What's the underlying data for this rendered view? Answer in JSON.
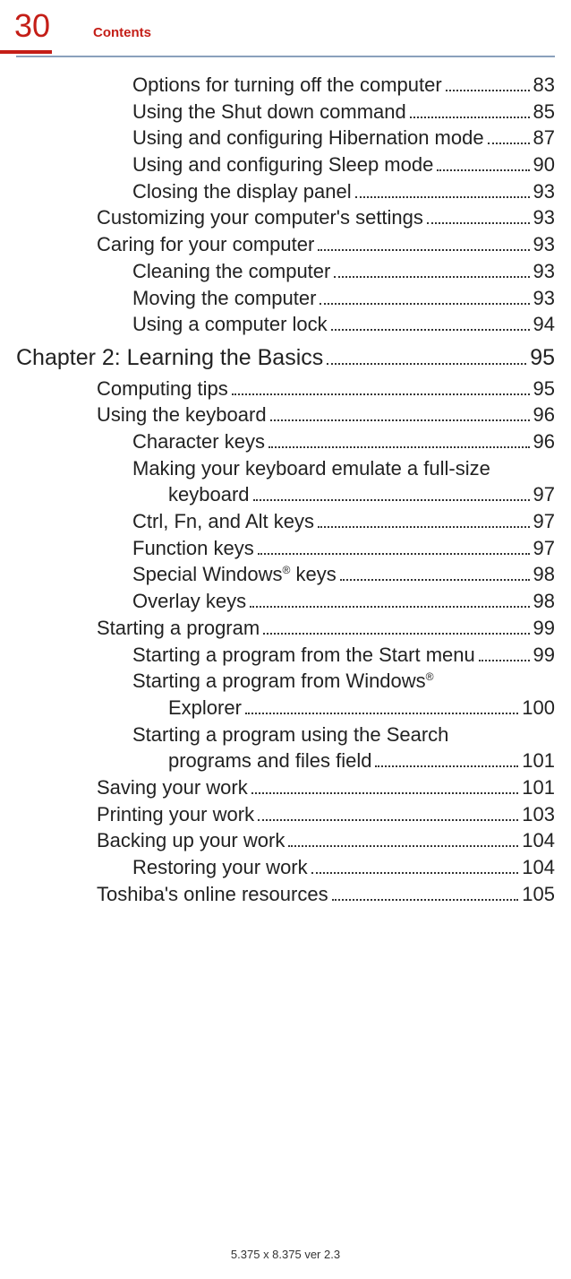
{
  "header": {
    "page_number": "30",
    "title": "Contents"
  },
  "toc": [
    {
      "text": "Options for turning off the computer",
      "page": "83",
      "indent": 2,
      "type": "item"
    },
    {
      "text": "Using the Shut down command",
      "page": "85",
      "indent": 2,
      "type": "item"
    },
    {
      "text": "Using and configuring Hibernation mode",
      "page": "87",
      "indent": 2,
      "type": "item"
    },
    {
      "text": "Using and configuring Sleep mode",
      "page": "90",
      "indent": 2,
      "type": "item"
    },
    {
      "text": "Closing the display panel",
      "page": "93",
      "indent": 2,
      "type": "item"
    },
    {
      "text": "Customizing your computer's settings",
      "page": "93",
      "indent": 1,
      "type": "item"
    },
    {
      "text": "Caring for your computer",
      "page": "93",
      "indent": 1,
      "type": "item"
    },
    {
      "text": "Cleaning the computer",
      "page": "93",
      "indent": 2,
      "type": "item"
    },
    {
      "text": "Moving the computer",
      "page": "93",
      "indent": 2,
      "type": "item"
    },
    {
      "text": "Using a computer lock",
      "page": "94",
      "indent": 2,
      "type": "item"
    },
    {
      "text": "Chapter 2: Learning the Basics",
      "page": " 95",
      "indent": 0,
      "type": "chapter"
    },
    {
      "text": "Computing tips",
      "page": "95",
      "indent": 1,
      "type": "item"
    },
    {
      "text": "Using the keyboard",
      "page": "96",
      "indent": 1,
      "type": "item"
    },
    {
      "text": "Character keys ",
      "page": "96",
      "indent": 2,
      "type": "item"
    },
    {
      "text": "Making your keyboard emulate a full-size",
      "cont": "keyboard",
      "page": "97",
      "indent": 2,
      "type": "wrap"
    },
    {
      "text": "Ctrl, Fn, and Alt keys",
      "page": "97",
      "indent": 2,
      "type": "item"
    },
    {
      "text": "Function keys",
      "page": "97",
      "indent": 2,
      "type": "item"
    },
    {
      "text_html": "Special Windows<span class=\"sup\">®</span> keys ",
      "page": "98",
      "indent": 2,
      "type": "item_html"
    },
    {
      "text": "Overlay keys",
      "page": "98",
      "indent": 2,
      "type": "item"
    },
    {
      "text": "Starting a program",
      "page": "99",
      "indent": 1,
      "type": "item"
    },
    {
      "text": "Starting a program from the Start menu",
      "page": "99",
      "indent": 2,
      "type": "item"
    },
    {
      "text_html": "Starting a program from Windows<span class=\"sup\">®</span>",
      "cont": "Explorer",
      "page": "100",
      "indent": 2,
      "type": "wrap_html"
    },
    {
      "text": "Starting a program using the Search",
      "cont": "programs and files field",
      "page": "101",
      "indent": 2,
      "type": "wrap"
    },
    {
      "text": "Saving your work",
      "page": "101",
      "indent": 1,
      "type": "item"
    },
    {
      "text": "Printing your work",
      "page": "103",
      "indent": 1,
      "type": "item"
    },
    {
      "text": "Backing up your work",
      "page": "104",
      "indent": 1,
      "type": "item"
    },
    {
      "text": "Restoring your work",
      "page": "104",
      "indent": 2,
      "type": "item"
    },
    {
      "text": "Toshiba's online resources",
      "page": "105",
      "indent": 1,
      "type": "item"
    }
  ],
  "footer": "5.375 x 8.375 ver 2.3"
}
